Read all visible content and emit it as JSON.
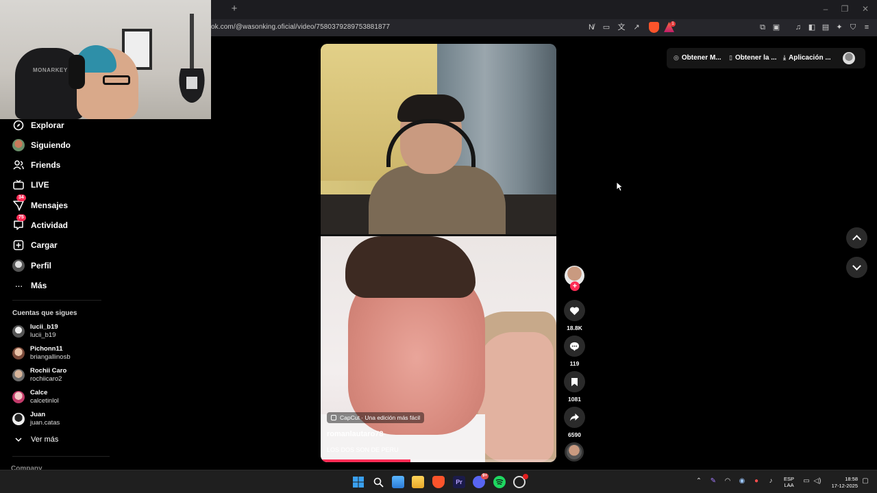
{
  "browser": {
    "new_tab_glyph": "+",
    "url": "ok.com/@wasonking.oficial/video/7580379289753881877",
    "window_controls": [
      "–",
      "❐",
      "✕"
    ],
    "brave_badge": "1"
  },
  "sidebar": {
    "items": [
      {
        "label": "Explorar",
        "icon": "compass-icon"
      },
      {
        "label": "Siguiendo",
        "icon": "avatar-icon"
      },
      {
        "label": "Friends",
        "icon": "friends-icon"
      },
      {
        "label": "LIVE",
        "icon": "live-icon"
      },
      {
        "label": "Mensajes",
        "icon": "messages-icon",
        "badge": "34"
      },
      {
        "label": "Actividad",
        "icon": "activity-icon",
        "badge": "75"
      },
      {
        "label": "Cargar",
        "icon": "upload-icon"
      },
      {
        "label": "Perfil",
        "icon": "profile-icon"
      },
      {
        "label": "Más",
        "icon": "more-icon"
      }
    ],
    "following_title": "Cuentas que sigues",
    "accounts": [
      {
        "name": "lucii_b19",
        "user": "lucii_b19"
      },
      {
        "name": "Pichonn11",
        "user": "briangallinosb"
      },
      {
        "name": "Rochii Caro",
        "user": "rochiicaro2"
      },
      {
        "name": "Calce",
        "user": "calcetinlol"
      },
      {
        "name": "Juan",
        "user": "juan.catas"
      }
    ],
    "see_more": "Ver más",
    "footer_partial": "Company"
  },
  "video": {
    "capcut_label": "CapCut · Una edición más fácil",
    "username": "romanlautaro78",
    "description": "LOS DOS SON DE PERU",
    "progress": 0.38
  },
  "actions": {
    "follow_glyph": "+",
    "likes": "18.8K",
    "comments": "119",
    "saves": "1081",
    "shares": "6590"
  },
  "topbar": {
    "get_m": "Obtener M...",
    "get_app": "Obtener la ...",
    "app": "Aplicación ..."
  },
  "taskbar": {
    "discord_badge": "9+",
    "lang_line1": "ESP",
    "lang_line2": "LAA",
    "time": "18:58",
    "date": "17-12-2025"
  },
  "colors": {
    "accent": "#fe2c55",
    "background": "#000000"
  }
}
